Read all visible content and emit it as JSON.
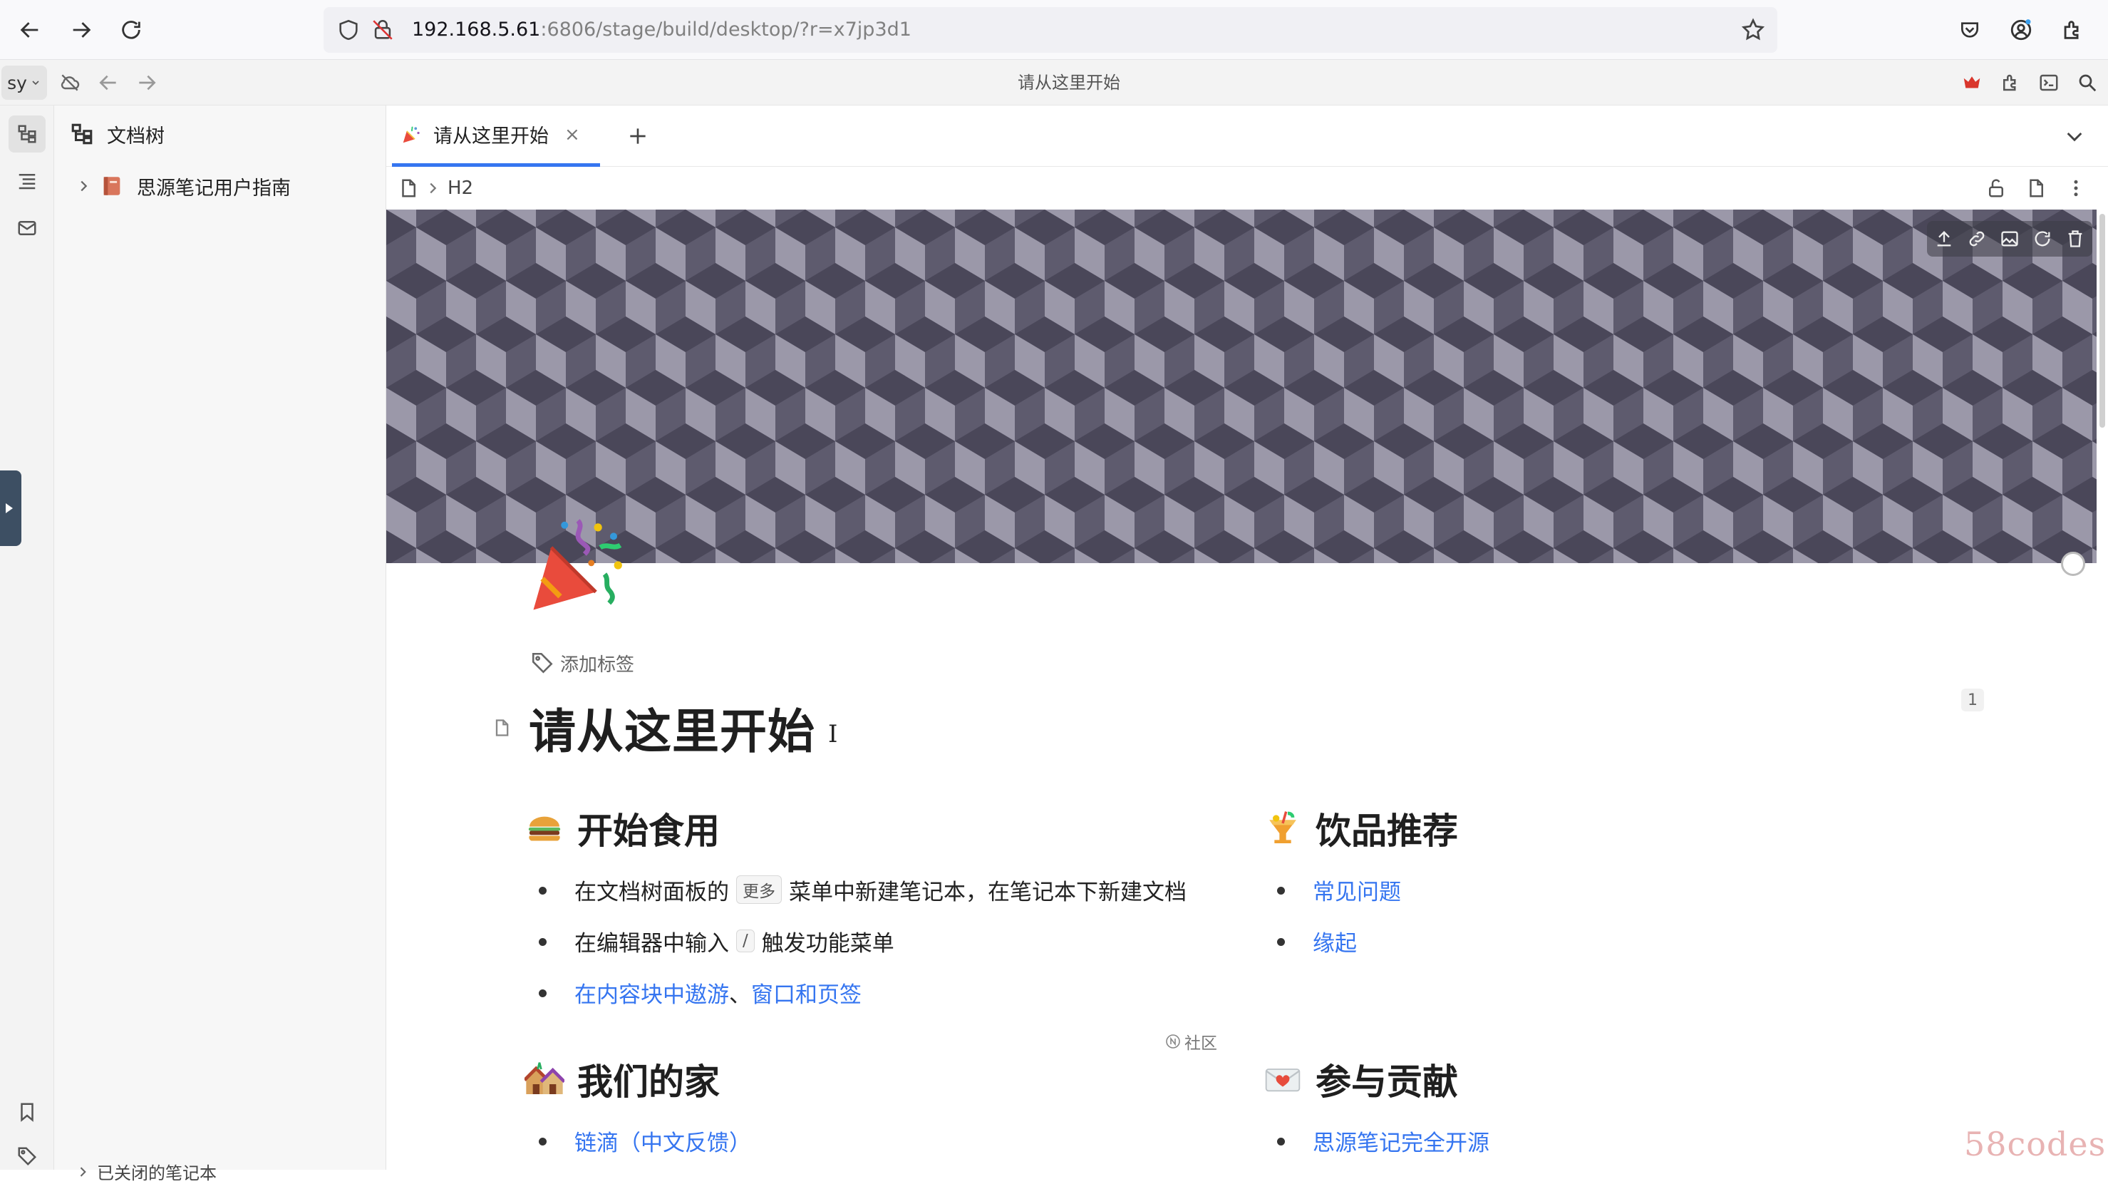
{
  "browser": {
    "url_host": "192.168.5.61",
    "url_rest": ":6806/stage/build/desktop/?r=x7jp3d1"
  },
  "app": {
    "workspace": "sy",
    "title": "请从这里开始"
  },
  "tree": {
    "title": "文档树",
    "notebooks": [
      {
        "label": "思源笔记用户指南"
      }
    ],
    "closed_notebooks_label": "已关闭的笔记本"
  },
  "tabs": {
    "active_label": "请从这里开始",
    "close_glyph": "×"
  },
  "breadcrumb": {
    "current": "H2"
  },
  "document": {
    "add_tag": "添加标签",
    "backlink_count": "1",
    "title": "请从这里开始",
    "sections": {
      "start": {
        "heading": "开始食用",
        "items": [
          {
            "before": "在文档树面板的",
            "kbd": "更多",
            "after": "菜单中新建笔记本，在笔记本下新建文档"
          },
          {
            "before": "在编辑器中输入",
            "kbd": "/",
            "after": "触发功能菜单"
          },
          {
            "link1": "在内容块中遨游",
            "sep": "、",
            "link2": "窗口和页签"
          }
        ]
      },
      "drinks": {
        "heading": "饮品推荐",
        "items": [
          {
            "link": "常见问题"
          },
          {
            "link": "缘起"
          }
        ]
      },
      "home": {
        "heading": "我们的家",
        "items": [
          {
            "link": "链滴（中文反馈）"
          }
        ]
      },
      "contribute": {
        "heading": "参与贡献",
        "items": [
          {
            "link": "思源笔记完全开源"
          }
        ]
      }
    },
    "community_badge": "社区"
  },
  "watermark": "58codes",
  "colors": {
    "accent": "#3575f0",
    "banner_dark": "#4a4759",
    "banner_mid": "#5e5b6e",
    "banner_light": "#9b98a9"
  }
}
